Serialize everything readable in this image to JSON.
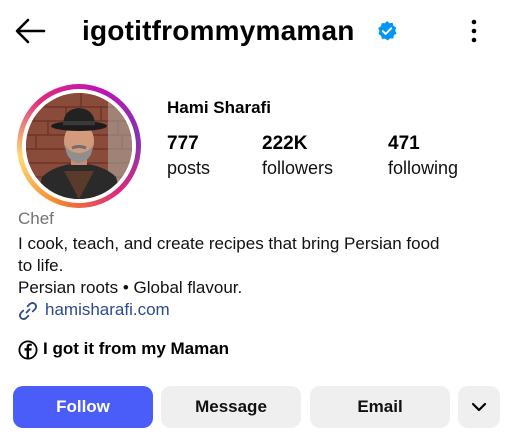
{
  "header": {
    "username": "igotitfrommymaman",
    "verified": true,
    "back_icon": "arrow-left-icon",
    "menu_icon": "more-vertical-icon"
  },
  "profile": {
    "full_name": "Hami Sharafi",
    "stats": [
      {
        "value": "777",
        "label": "posts"
      },
      {
        "value": "222K",
        "label": "followers"
      },
      {
        "value": "471",
        "label": "following"
      }
    ],
    "category": "Chef",
    "bio_lines": [
      "I cook, teach, and create recipes that bring Persian food",
      "to life.",
      "Persian roots • Global flavour."
    ],
    "link": "hamisharafi.com",
    "facebook_page": "I got it from my Maman"
  },
  "actions": {
    "follow": "Follow",
    "message": "Message",
    "email": "Email",
    "more_icon": "chevron-down-icon"
  },
  "colors": {
    "verified_blue": "#0095f6",
    "follow_button": "#4a5df9",
    "link": "#2c4a8f",
    "secondary_text": "#737373",
    "button_gray": "#efefef"
  }
}
